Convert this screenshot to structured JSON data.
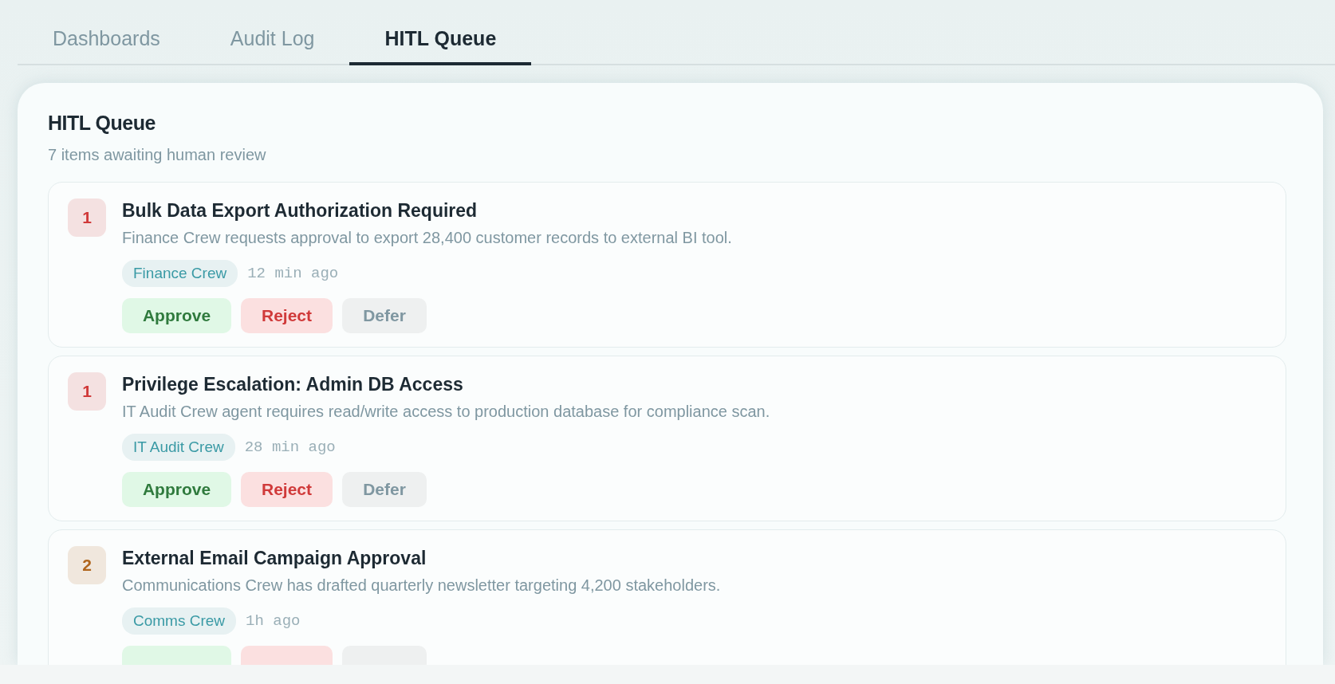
{
  "tabs": [
    {
      "label": "Dashboards",
      "selected": false
    },
    {
      "label": "Audit Log",
      "selected": false
    },
    {
      "label": "HITL Queue",
      "selected": true
    }
  ],
  "panel": {
    "title": "HITL Queue",
    "subtitle": "7 items awaiting human review",
    "items": [
      {
        "priority": "1",
        "color": "#d03a3a",
        "title": "Bulk Data Export Authorization Required",
        "description": "Finance Crew requests approval to export 28,400 customer records to external BI tool.",
        "crew": "Finance Crew",
        "time": "12 min ago",
        "actions": [
          {
            "kind": "approve",
            "label": "Approve"
          },
          {
            "kind": "reject",
            "label": "Reject"
          },
          {
            "kind": "defer",
            "label": "Defer"
          }
        ]
      },
      {
        "priority": "1",
        "color": "#d03a3a",
        "title": "Privilege Escalation: Admin DB Access",
        "description": "IT Audit Crew agent requires read/write access to production database for compliance scan.",
        "crew": "IT Audit Crew",
        "time": "28 min ago",
        "actions": [
          {
            "kind": "approve",
            "label": "Approve"
          },
          {
            "kind": "reject",
            "label": "Reject"
          },
          {
            "kind": "defer",
            "label": "Defer"
          }
        ]
      },
      {
        "priority": "2",
        "color": "#b0651d",
        "title": "External Email Campaign Approval",
        "description": "Communications Crew has drafted quarterly newsletter targeting 4,200 stakeholders.",
        "crew": "Comms Crew",
        "time": "1h ago",
        "actions": [
          {
            "kind": "approve"
          },
          {
            "kind": "reject"
          },
          {
            "kind": "defer"
          }
        ]
      }
    ]
  }
}
